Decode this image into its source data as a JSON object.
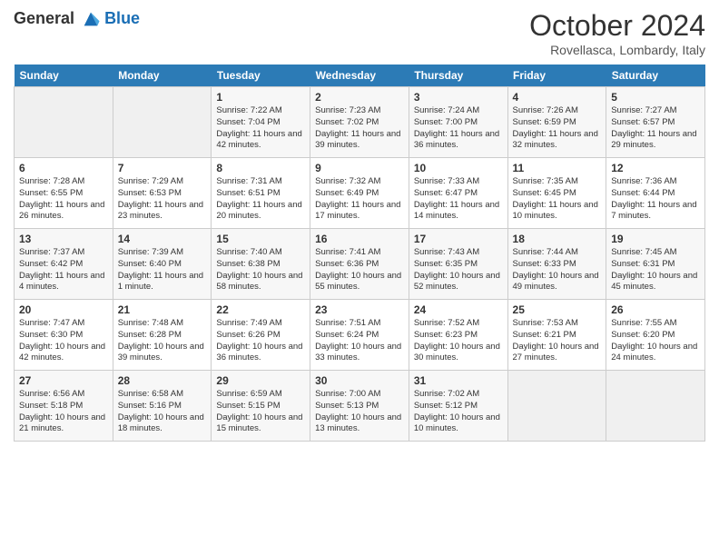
{
  "header": {
    "logo_line1": "General",
    "logo_line2": "Blue",
    "month": "October 2024",
    "location": "Rovellasca, Lombardy, Italy"
  },
  "weekdays": [
    "Sunday",
    "Monday",
    "Tuesday",
    "Wednesday",
    "Thursday",
    "Friday",
    "Saturday"
  ],
  "weeks": [
    [
      {
        "day": "",
        "info": ""
      },
      {
        "day": "",
        "info": ""
      },
      {
        "day": "1",
        "info": "Sunrise: 7:22 AM\nSunset: 7:04 PM\nDaylight: 11 hours and 42 minutes."
      },
      {
        "day": "2",
        "info": "Sunrise: 7:23 AM\nSunset: 7:02 PM\nDaylight: 11 hours and 39 minutes."
      },
      {
        "day": "3",
        "info": "Sunrise: 7:24 AM\nSunset: 7:00 PM\nDaylight: 11 hours and 36 minutes."
      },
      {
        "day": "4",
        "info": "Sunrise: 7:26 AM\nSunset: 6:59 PM\nDaylight: 11 hours and 32 minutes."
      },
      {
        "day": "5",
        "info": "Sunrise: 7:27 AM\nSunset: 6:57 PM\nDaylight: 11 hours and 29 minutes."
      }
    ],
    [
      {
        "day": "6",
        "info": "Sunrise: 7:28 AM\nSunset: 6:55 PM\nDaylight: 11 hours and 26 minutes."
      },
      {
        "day": "7",
        "info": "Sunrise: 7:29 AM\nSunset: 6:53 PM\nDaylight: 11 hours and 23 minutes."
      },
      {
        "day": "8",
        "info": "Sunrise: 7:31 AM\nSunset: 6:51 PM\nDaylight: 11 hours and 20 minutes."
      },
      {
        "day": "9",
        "info": "Sunrise: 7:32 AM\nSunset: 6:49 PM\nDaylight: 11 hours and 17 minutes."
      },
      {
        "day": "10",
        "info": "Sunrise: 7:33 AM\nSunset: 6:47 PM\nDaylight: 11 hours and 14 minutes."
      },
      {
        "day": "11",
        "info": "Sunrise: 7:35 AM\nSunset: 6:45 PM\nDaylight: 11 hours and 10 minutes."
      },
      {
        "day": "12",
        "info": "Sunrise: 7:36 AM\nSunset: 6:44 PM\nDaylight: 11 hours and 7 minutes."
      }
    ],
    [
      {
        "day": "13",
        "info": "Sunrise: 7:37 AM\nSunset: 6:42 PM\nDaylight: 11 hours and 4 minutes."
      },
      {
        "day": "14",
        "info": "Sunrise: 7:39 AM\nSunset: 6:40 PM\nDaylight: 11 hours and 1 minute."
      },
      {
        "day": "15",
        "info": "Sunrise: 7:40 AM\nSunset: 6:38 PM\nDaylight: 10 hours and 58 minutes."
      },
      {
        "day": "16",
        "info": "Sunrise: 7:41 AM\nSunset: 6:36 PM\nDaylight: 10 hours and 55 minutes."
      },
      {
        "day": "17",
        "info": "Sunrise: 7:43 AM\nSunset: 6:35 PM\nDaylight: 10 hours and 52 minutes."
      },
      {
        "day": "18",
        "info": "Sunrise: 7:44 AM\nSunset: 6:33 PM\nDaylight: 10 hours and 49 minutes."
      },
      {
        "day": "19",
        "info": "Sunrise: 7:45 AM\nSunset: 6:31 PM\nDaylight: 10 hours and 45 minutes."
      }
    ],
    [
      {
        "day": "20",
        "info": "Sunrise: 7:47 AM\nSunset: 6:30 PM\nDaylight: 10 hours and 42 minutes."
      },
      {
        "day": "21",
        "info": "Sunrise: 7:48 AM\nSunset: 6:28 PM\nDaylight: 10 hours and 39 minutes."
      },
      {
        "day": "22",
        "info": "Sunrise: 7:49 AM\nSunset: 6:26 PM\nDaylight: 10 hours and 36 minutes."
      },
      {
        "day": "23",
        "info": "Sunrise: 7:51 AM\nSunset: 6:24 PM\nDaylight: 10 hours and 33 minutes."
      },
      {
        "day": "24",
        "info": "Sunrise: 7:52 AM\nSunset: 6:23 PM\nDaylight: 10 hours and 30 minutes."
      },
      {
        "day": "25",
        "info": "Sunrise: 7:53 AM\nSunset: 6:21 PM\nDaylight: 10 hours and 27 minutes."
      },
      {
        "day": "26",
        "info": "Sunrise: 7:55 AM\nSunset: 6:20 PM\nDaylight: 10 hours and 24 minutes."
      }
    ],
    [
      {
        "day": "27",
        "info": "Sunrise: 6:56 AM\nSunset: 5:18 PM\nDaylight: 10 hours and 21 minutes."
      },
      {
        "day": "28",
        "info": "Sunrise: 6:58 AM\nSunset: 5:16 PM\nDaylight: 10 hours and 18 minutes."
      },
      {
        "day": "29",
        "info": "Sunrise: 6:59 AM\nSunset: 5:15 PM\nDaylight: 10 hours and 15 minutes."
      },
      {
        "day": "30",
        "info": "Sunrise: 7:00 AM\nSunset: 5:13 PM\nDaylight: 10 hours and 13 minutes."
      },
      {
        "day": "31",
        "info": "Sunrise: 7:02 AM\nSunset: 5:12 PM\nDaylight: 10 hours and 10 minutes."
      },
      {
        "day": "",
        "info": ""
      },
      {
        "day": "",
        "info": ""
      }
    ]
  ]
}
